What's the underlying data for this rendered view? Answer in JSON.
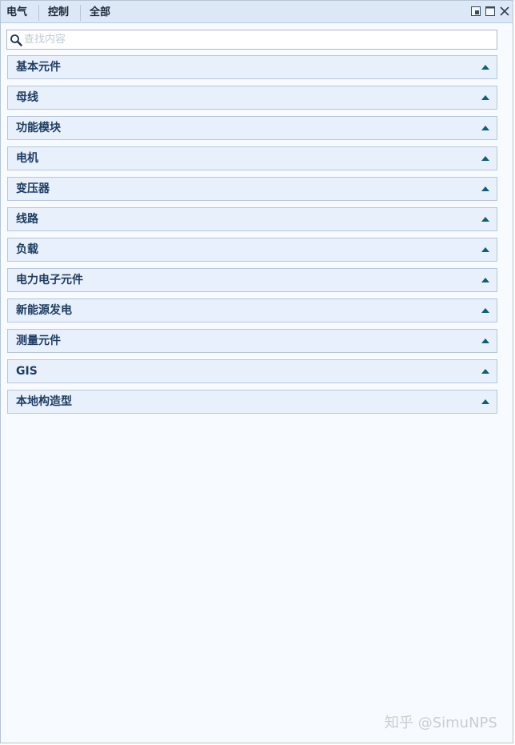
{
  "tabs": [
    {
      "label": "电气"
    },
    {
      "label": "控制"
    },
    {
      "label": "全部"
    }
  ],
  "window_controls": {
    "icons": [
      "restore-icon",
      "maximize-icon",
      "close-icon"
    ]
  },
  "search": {
    "placeholder": "查找内容",
    "value": "",
    "icon": "search-icon"
  },
  "sections": [
    {
      "label": "基本元件"
    },
    {
      "label": "母线"
    },
    {
      "label": "功能模块"
    },
    {
      "label": "电机"
    },
    {
      "label": "变压器"
    },
    {
      "label": "线路"
    },
    {
      "label": "负载"
    },
    {
      "label": "电力电子元件"
    },
    {
      "label": "新能源发电"
    },
    {
      "label": "测量元件"
    },
    {
      "label": "GIS"
    },
    {
      "label": "本地构造型"
    }
  ],
  "section_arrow_icon": "collapse-arrow-up-icon",
  "watermark": "知乎 @SimuNPS",
  "colors": {
    "tabbar_bg": "#dce8f5",
    "section_bg": "#e7f0fb",
    "section_text": "#1f3d64",
    "arrow": "#0d5f7a",
    "panel_bg": "#f7faff"
  }
}
